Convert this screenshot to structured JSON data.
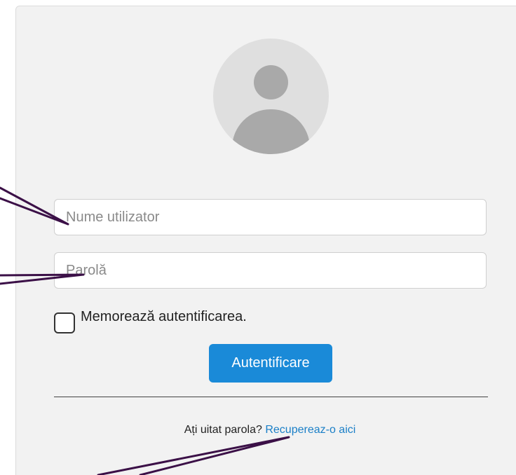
{
  "login": {
    "username_placeholder": "Nume utilizator",
    "password_placeholder": "Parolă",
    "remember_label": "Memorează autentificarea.",
    "submit_label": "Autentificare",
    "forgot_text": "Ați uitat parola?",
    "recover_link": "Recupereaz-o aici"
  },
  "colors": {
    "card_background": "#f2f2f2",
    "button": "#1a8ad8",
    "link": "#1a7fc7",
    "annotation_arrow": "#3b1047"
  }
}
